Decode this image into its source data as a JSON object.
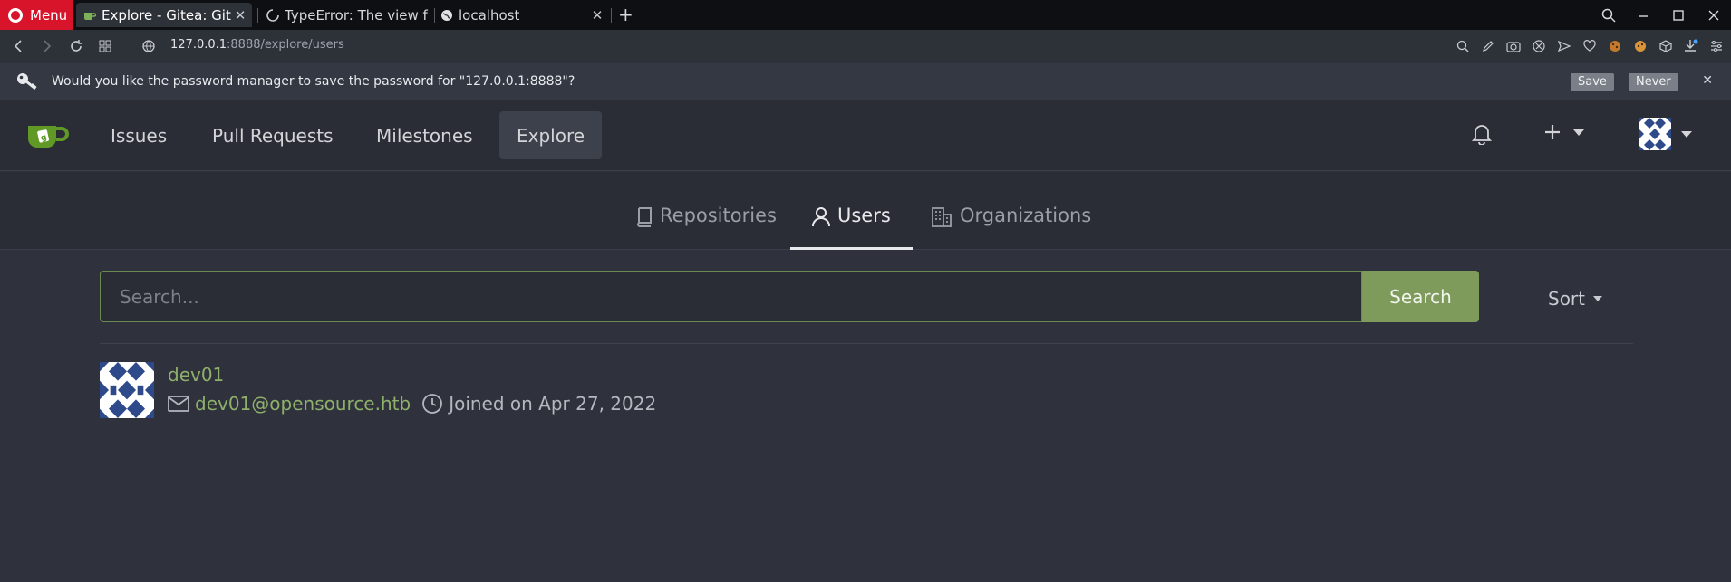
{
  "browser": {
    "menu_label": "Menu",
    "tabs": [
      {
        "title": "Explore - Gitea: Git w",
        "active": true
      },
      {
        "title": "TypeError: The view f",
        "active": false
      },
      {
        "title": "localhost",
        "active": false
      }
    ],
    "url_host": "127.0.0.1",
    "url_rest": ":8888/explore/users",
    "password_prompt": {
      "message": "Would you like the password manager to save the password for \"127.0.0.1:8888\"?",
      "save_label": "Save",
      "never_label": "Never"
    }
  },
  "gitea": {
    "nav": [
      "Issues",
      "Pull Requests",
      "Milestones",
      "Explore"
    ],
    "active_nav": "Explore",
    "subtabs": [
      "Repositories",
      "Users",
      "Organizations"
    ],
    "active_subtab": "Users",
    "search": {
      "placeholder": "Search...",
      "button_label": "Search"
    },
    "sort_label": "Sort",
    "users": [
      {
        "name": "dev01",
        "email": "dev01@opensource.htb",
        "joined": "Joined on Apr 27, 2022"
      }
    ]
  },
  "colors": {
    "accent_green": "#8fb06a",
    "search_button": "#7e9b5c",
    "opera_red": "#d8142a"
  }
}
